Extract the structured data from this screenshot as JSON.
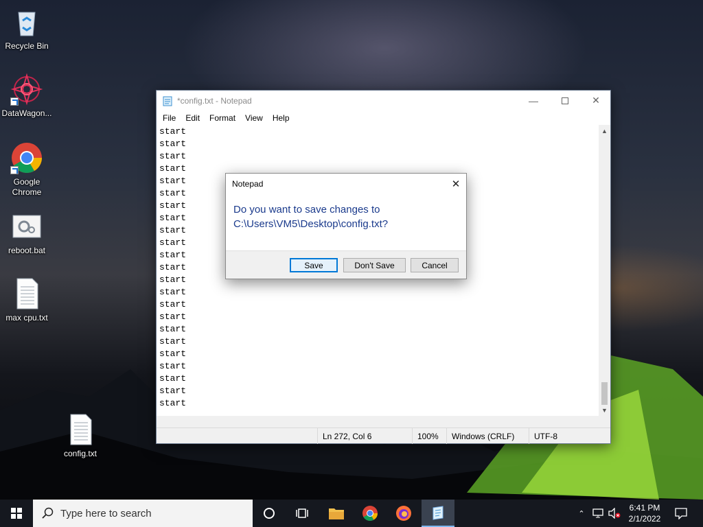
{
  "desktop": {
    "icons": [
      {
        "label": "Recycle Bin",
        "icon": "recycle-bin-icon"
      },
      {
        "label": "DataWagon...",
        "icon": "datawagon-icon"
      },
      {
        "label": "Google\nChrome",
        "icon": "chrome-icon"
      },
      {
        "label": "reboot.bat",
        "icon": "batch-file-icon"
      },
      {
        "label": "max cpu.txt",
        "icon": "text-file-icon"
      },
      {
        "label": "config.txt",
        "icon": "text-file-icon"
      }
    ]
  },
  "notepad": {
    "title": "*config.txt - Notepad",
    "menu": [
      "File",
      "Edit",
      "Format",
      "View",
      "Help"
    ],
    "lines": [
      "start",
      "start",
      "start",
      "start",
      "start",
      "start",
      "start",
      "start",
      "start",
      "start",
      "start",
      "start",
      "start",
      "start",
      "start",
      "start",
      "start",
      "start",
      "start",
      "start",
      "start",
      "start",
      "start"
    ],
    "status": {
      "position": "Ln 272, Col 6",
      "zoom": "100%",
      "line_ending": "Windows (CRLF)",
      "encoding": "UTF-8"
    }
  },
  "dialog": {
    "title": "Notepad",
    "message_line1": "Do you want to save changes to",
    "message_line2": "C:\\Users\\VM5\\Desktop\\config.txt?",
    "buttons": {
      "save": "Save",
      "dont_save": "Don't Save",
      "cancel": "Cancel"
    }
  },
  "taskbar": {
    "search_placeholder": "Type here to search",
    "apps": [
      "cortana-icon",
      "task-view-icon",
      "file-explorer-icon",
      "chrome-icon",
      "firefox-icon",
      "notepad-icon"
    ],
    "time": "6:41 PM",
    "date": "2/1/2022"
  },
  "colors": {
    "dialog_message": "#1a3a8c",
    "accent": "#0078d7",
    "taskbar": "#15181f"
  }
}
